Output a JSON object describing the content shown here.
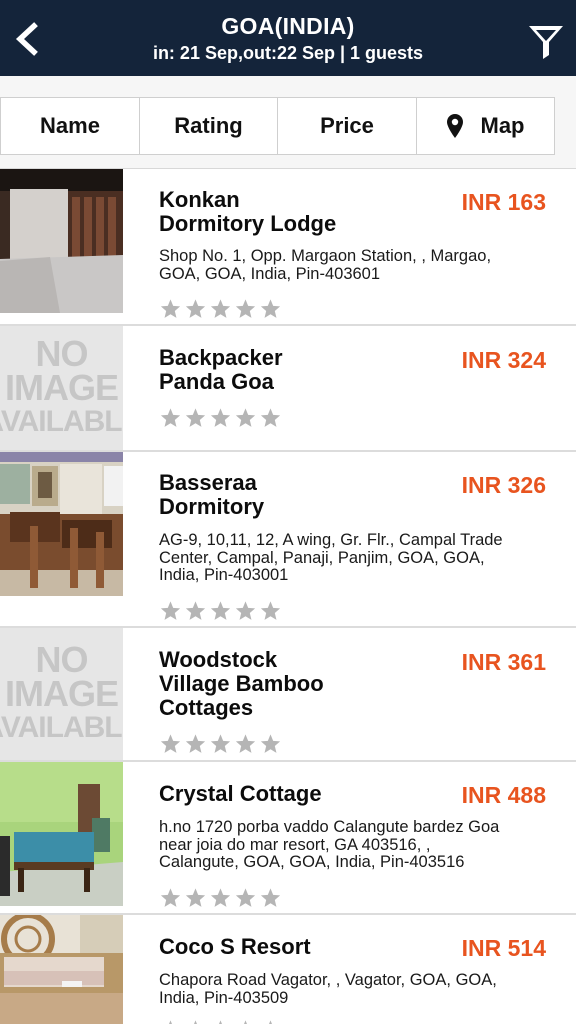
{
  "header": {
    "title": "GOA(INDIA)",
    "subtitle": "in: 21 Sep,out:22 Sep | 1 guests"
  },
  "sort": {
    "name": "Name",
    "rating": "Rating",
    "price": "Price",
    "map": "Map"
  },
  "no_image": {
    "line1": "NO",
    "line2": "IMAGE",
    "line3": "AVAILABLE"
  },
  "colors": {
    "header_bg": "#14243a",
    "price": "#e8541f",
    "star": "#b5b5b5"
  },
  "hotels": [
    {
      "name_l1": "Konkan",
      "name_l2": "Dormitory Lodge",
      "name_l3": "",
      "price": "INR 163",
      "addr_l1": "Shop No. 1, Opp. Margaon Station, , Margao,",
      "addr_l2": "GOA, GOA, India, Pin-403601",
      "addr_l3": "",
      "rating": 0
    },
    {
      "name_l1": "Backpacker",
      "name_l2": "Panda Goa",
      "name_l3": "",
      "price": "INR 324",
      "addr_l1": "",
      "addr_l2": "",
      "addr_l3": "",
      "rating": 0
    },
    {
      "name_l1": "Basseraa",
      "name_l2": "Dormitory",
      "name_l3": "",
      "price": "INR 326",
      "addr_l1": "AG-9, 10,11, 12, A wing, Gr. Flr., Campal Trade",
      "addr_l2": "Center, Campal, Panaji, Panjim, GOA, GOA,",
      "addr_l3": "India, Pin-403001",
      "rating": 0
    },
    {
      "name_l1": "Woodstock",
      "name_l2": "Village Bamboo",
      "name_l3": "Cottages",
      "price": "INR 361",
      "addr_l1": "",
      "addr_l2": "",
      "addr_l3": "",
      "rating": 0
    },
    {
      "name_l1": "Crystal Cottage",
      "name_l2": "",
      "name_l3": "",
      "price": "INR 488",
      "addr_l1": "h.no 1720 porba vaddo Calangute bardez Goa",
      "addr_l2": "near joia do mar resort, GA 403516, ,",
      "addr_l3": "Calangute, GOA, GOA, India, Pin-403516",
      "rating": 0
    },
    {
      "name_l1": "Coco S Resort",
      "name_l2": "",
      "name_l3": "",
      "price": "INR 514",
      "addr_l1": "Chapora Road Vagator, , Vagator, GOA, GOA,",
      "addr_l2": "India, Pin-403509",
      "addr_l3": "",
      "rating": 0
    }
  ]
}
